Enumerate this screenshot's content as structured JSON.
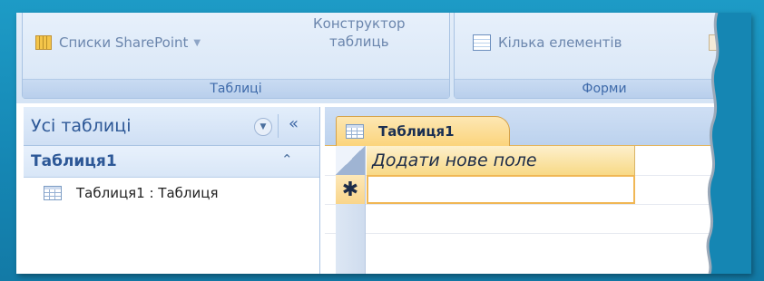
{
  "ribbon": {
    "tables_group": {
      "sharepoint_lists": "Списки SharePoint",
      "table_designer_line1": "Конструктор",
      "table_designer_line2": "таблиць",
      "caption": "Таблиці"
    },
    "forms_group": {
      "multiple_items": "Кілька елементів",
      "caption": "Форми"
    }
  },
  "nav_pane": {
    "title": "Усі таблиці",
    "dropdown_icon": "chevron-down-circle-icon",
    "collapse_symbol": "«",
    "group_name": "Таблиця1",
    "group_toggle_symbol": "≈",
    "items": [
      {
        "label": "Таблиця1 : Таблиця",
        "icon": "table-icon"
      }
    ]
  },
  "document": {
    "tab_label": "Таблиця1",
    "add_field_label": "Додати нове поле",
    "new_record_marker": "✱"
  },
  "colors": {
    "background": "#1586b3",
    "ribbon": "#dbe8f7",
    "accent_text": "#2d5897",
    "active_tab": "#fbd47c"
  }
}
